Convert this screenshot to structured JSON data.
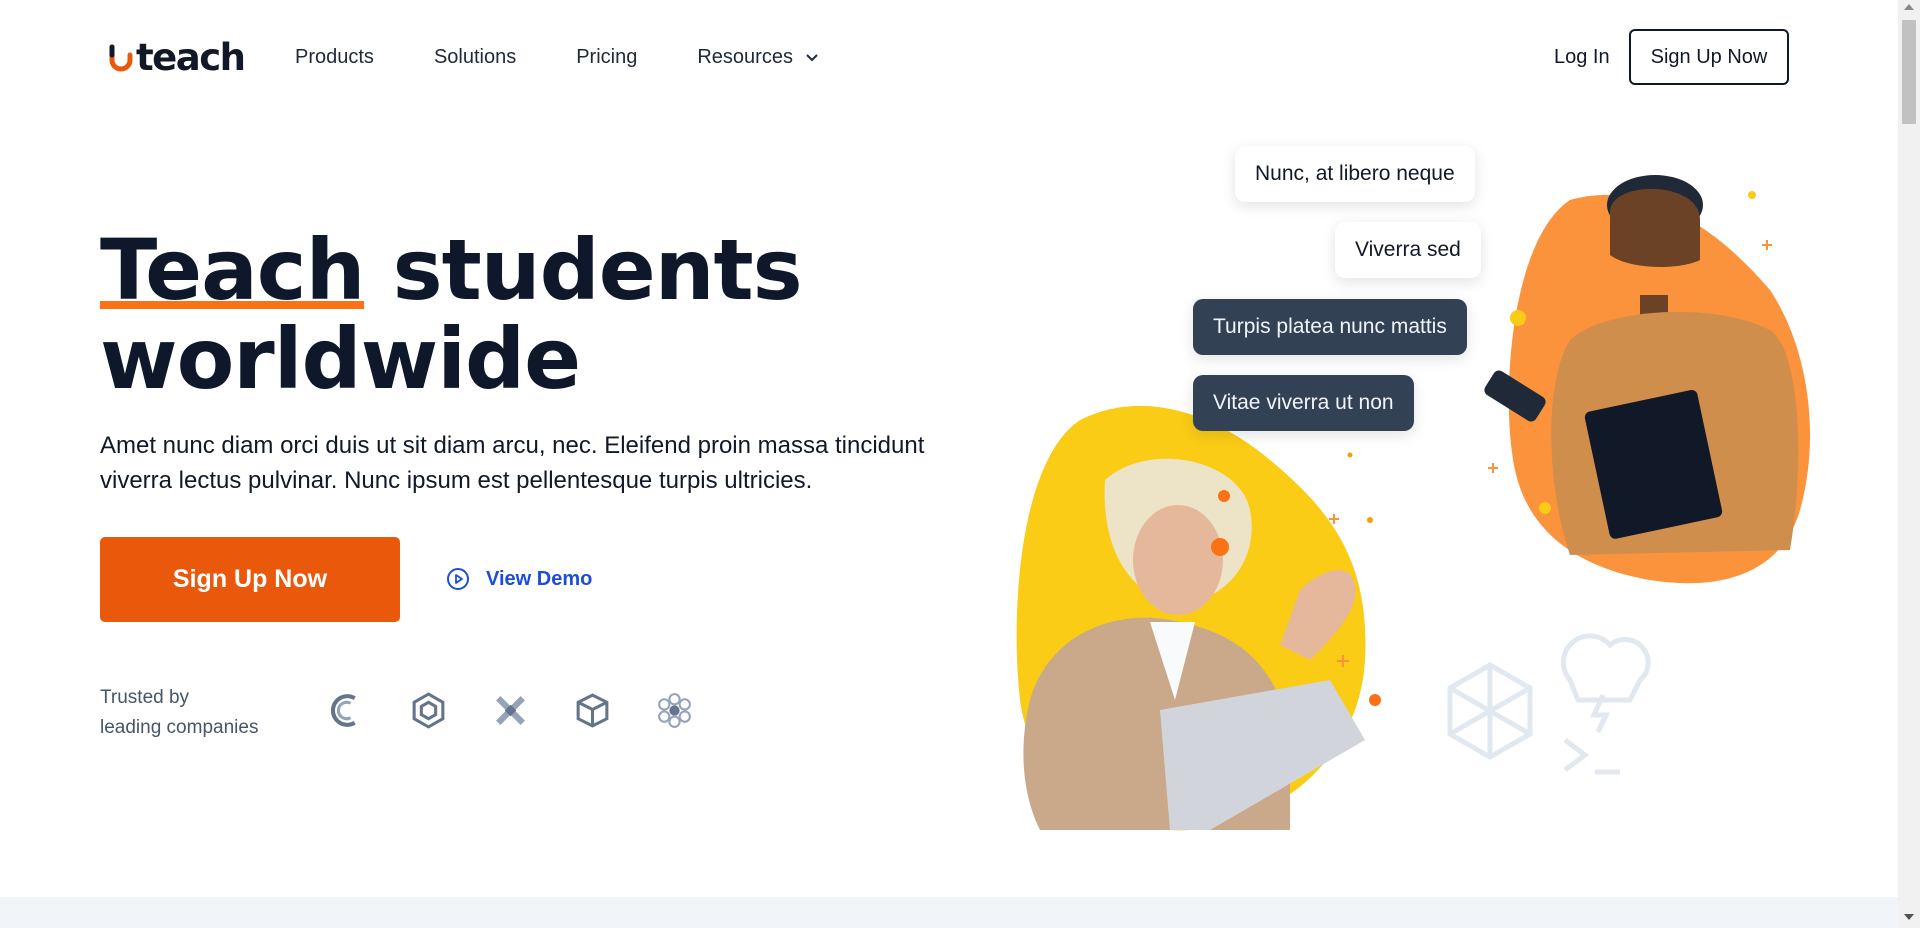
{
  "brand": {
    "name": "teach",
    "accent": "#ea580c"
  },
  "nav": {
    "links": [
      {
        "label": "Products"
      },
      {
        "label": "Solutions"
      },
      {
        "label": "Pricing"
      },
      {
        "label": "Resources",
        "icon": "chevron-down-icon"
      }
    ],
    "login_label": "Log In",
    "signup_label": "Sign Up Now"
  },
  "hero": {
    "headline_highlight": "Teach",
    "headline_rest_line1": " students",
    "headline_line2": "worldwide",
    "subtext": "Amet nunc diam orci duis ut sit diam arcu, nec. Eleifend proin massa tincidunt viverra lectus pulvinar. Nunc ipsum est pellentesque turpis ultricies.",
    "cta_primary": "Sign Up Now",
    "cta_demo": "View Demo",
    "trusted_line1": "Trusted by",
    "trusted_line2": "leading companies",
    "company_logos": [
      "company-logo-1",
      "company-logo-2",
      "company-logo-3",
      "company-logo-4",
      "company-logo-5"
    ]
  },
  "chat_bubbles": [
    {
      "text": "Nunc, at libero neque",
      "style": "light"
    },
    {
      "text": "Viverra sed",
      "style": "light"
    },
    {
      "text": "Turpis platea nunc mattis",
      "style": "dark"
    },
    {
      "text": "Vitae viverra ut non",
      "style": "dark"
    }
  ],
  "colors": {
    "orange_blob": "#fb923c",
    "yellow_blob": "#facc15",
    "dark_bubble": "#334155"
  }
}
